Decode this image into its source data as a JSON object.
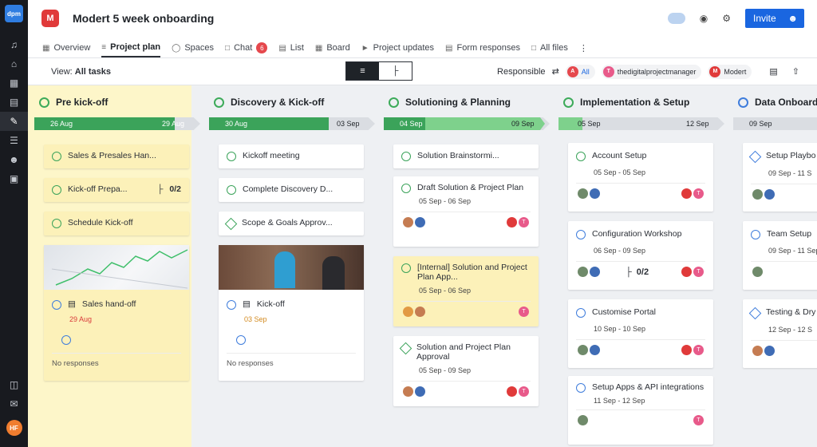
{
  "rail": {
    "logo": "dpm",
    "user_initials": "HF"
  },
  "project": {
    "logo_letter": "M",
    "title": "Modert 5 week onboarding"
  },
  "header": {
    "invite_label": "Invite"
  },
  "tabs": [
    {
      "label": "Overview"
    },
    {
      "label": "Project plan"
    },
    {
      "label": "Spaces"
    },
    {
      "label": "Chat",
      "badge": "6"
    },
    {
      "label": "List"
    },
    {
      "label": "Board"
    },
    {
      "label": "Project updates"
    },
    {
      "label": "Form responses"
    },
    {
      "label": "All files"
    }
  ],
  "toolbar": {
    "view_prefix": "View:",
    "view_value": "All tasks",
    "responsible_label": "Responsible",
    "filters": [
      {
        "initial": "A",
        "label": "All",
        "color": "#e5484d"
      },
      {
        "initial": "T",
        "label": "thedigitalprojectmanager",
        "color": "#e85a8a"
      },
      {
        "initial": "M",
        "label": "Modert",
        "color": "#e03a3a"
      }
    ]
  },
  "columns": [
    {
      "title": "Pre kick-off",
      "start": "26 Aug",
      "end": "29 Aug",
      "cards": [
        {
          "title": "Sales & Presales Han..."
        },
        {
          "title": "Kick-off Prepa...",
          "count": "0/2"
        },
        {
          "title": "Schedule Kick-off"
        }
      ],
      "media": {
        "title": "Sales hand-off",
        "date": "29 Aug",
        "note": "No responses"
      }
    },
    {
      "title": "Discovery & Kick-off",
      "start": "30 Aug",
      "end": "03 Sep",
      "cards": [
        {
          "title": "Kickoff meeting"
        },
        {
          "title": "Complete Discovery D..."
        },
        {
          "title": "Scope & Goals Approv..."
        }
      ],
      "media": {
        "title": "Kick-off",
        "date": "03 Sep",
        "note": "No responses"
      }
    },
    {
      "title": "Solutioning & Planning",
      "start": "04 Sep",
      "end": "09 Sep",
      "cards": [
        {
          "title": "Solution Brainstormi..."
        },
        {
          "title": "Draft Solution & Project Plan",
          "dates": "05 Sep - 06 Sep"
        },
        {
          "title": "[Internal] Solution and Project Plan App...",
          "dates": "05 Sep - 06 Sep"
        },
        {
          "title": "Solution and Project Plan Approval",
          "dates": "05 Sep - 09 Sep"
        }
      ]
    },
    {
      "title": "Implementation & Setup",
      "start": "05 Sep",
      "end": "12 Sep",
      "cards": [
        {
          "title": "Account Setup",
          "dates": "05 Sep - 05 Sep"
        },
        {
          "title": "Configuration Workshop",
          "dates": "06 Sep - 09 Sep",
          "count": "0/2"
        },
        {
          "title": "Customise Portal",
          "dates": "10 Sep - 10 Sep"
        },
        {
          "title": "Setup Apps & API integrations",
          "dates": "11 Sep - 12 Sep"
        }
      ]
    },
    {
      "title": "Data Onboardi",
      "start": "09 Sep",
      "cards": [
        {
          "title": "Setup Playbo",
          "dates": "09 Sep - 11 S"
        },
        {
          "title": "Team Setup",
          "dates": "09 Sep - 11 Sep"
        },
        {
          "title": "Testing & Dry",
          "dates": "12 Sep - 12 S"
        }
      ]
    }
  ]
}
